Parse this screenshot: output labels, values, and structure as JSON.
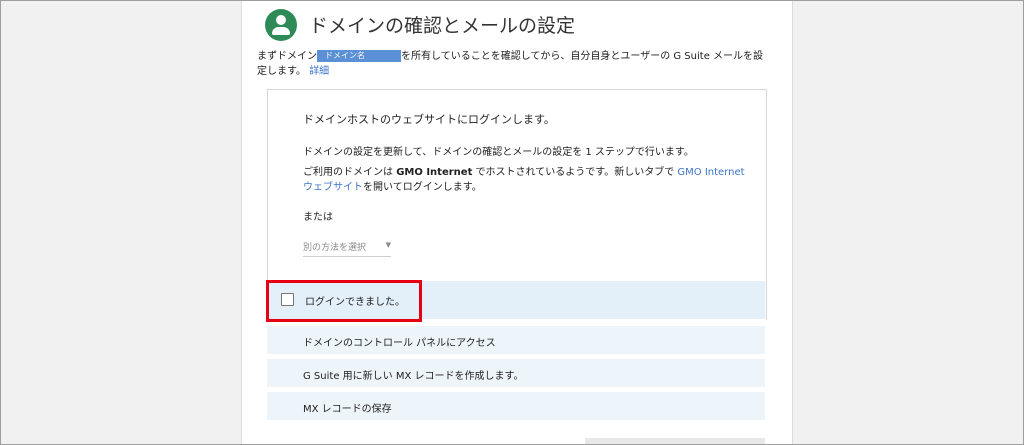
{
  "dialog": {
    "title": "ドメインの確認とメールの設定",
    "intro_before": "まずドメイン",
    "intro_highlight": "ドメイン名",
    "intro_after": "を所有していることを確認してから、自分自身とユーザーの G Suite メールを設定します。",
    "intro_link": "詳細"
  },
  "panel": {
    "heading": "ドメインホストのウェブサイトにログインします。",
    "description": "ドメインの設定を更新して、ドメインの確認とメールの設定を 1 ステップで行います。",
    "gmo_prefix": "ご利用のドメインは ",
    "gmo_bold": "GMO Internet",
    "gmo_middle": " でホストされているようです。新しいタブで ",
    "gmo_link": "GMO Internet ウェブサイト",
    "gmo_suffix": "を開いてログインします。",
    "or_text": "または",
    "select_placeholder": "別の方法を選択"
  },
  "confirm": {
    "checkbox_label": "ログインできました。",
    "checked": false
  },
  "steps": [
    "ドメインのコントロール パネルにアクセス",
    "G Suite 用に新しい MX レコードを作成します。",
    "MX レコードの保存"
  ],
  "colors": {
    "avatar": "#2e8b57",
    "link": "#3b73c9",
    "highlight": "#e60012",
    "selected_row": "#e3f0fa"
  }
}
